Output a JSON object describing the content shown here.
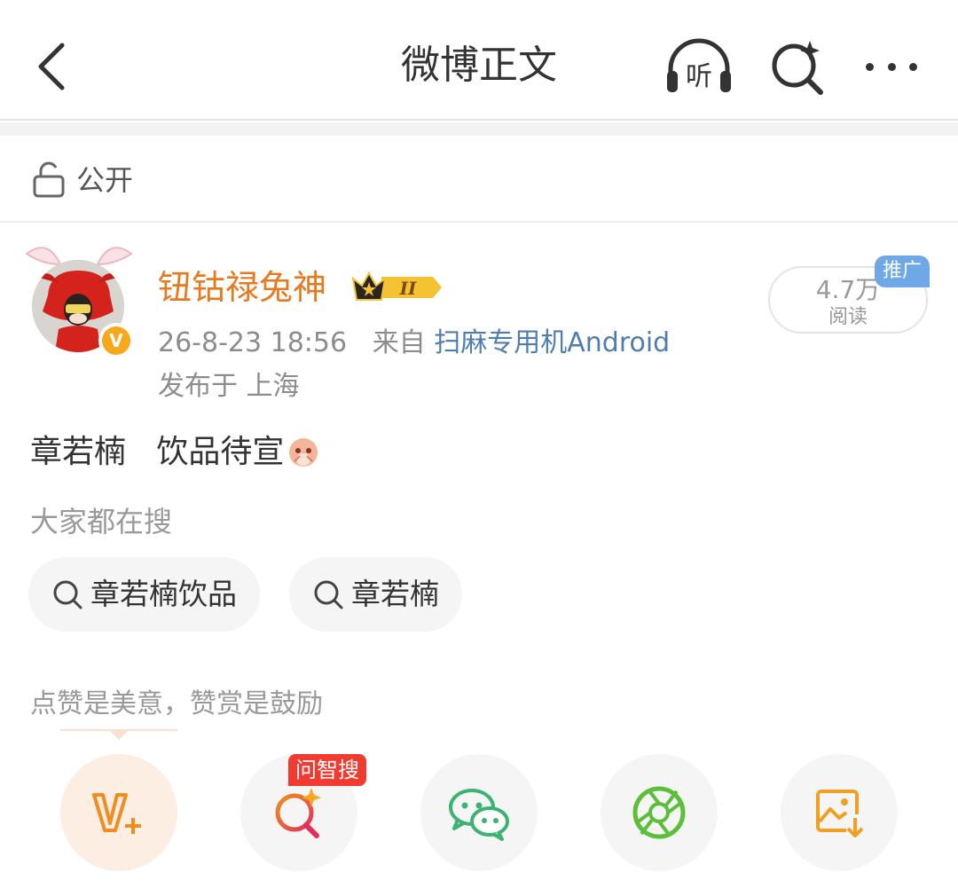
{
  "header": {
    "title": "微博正文",
    "listen_label": "听"
  },
  "visibility": {
    "label": "公开"
  },
  "post": {
    "author": "钮钴禄兔神",
    "vip_level": "II",
    "avatar_badge": "V",
    "time": "26-8-23 18:56",
    "source_prefix": "来自",
    "source": "扫麻专用机Android",
    "location": "发布于 上海",
    "reads_count": "4.7万",
    "reads_label": "阅读",
    "promo_tag": "推广",
    "text": "章若楠   饮品待宣"
  },
  "related_search": {
    "title": "大家都在搜",
    "chips": [
      {
        "label": "章若楠饮品"
      },
      {
        "label": "章若楠"
      }
    ]
  },
  "actions": {
    "tip": "点赞是美意，赞赏是鼓励",
    "ai_tag": "问智搜",
    "buttons": [
      {
        "icon": "reward-v-plus-icon",
        "color": "#f08c20"
      },
      {
        "icon": "ai-search-icon",
        "color": "#e83e5a"
      },
      {
        "icon": "wechat-icon",
        "color": "#3cb371"
      },
      {
        "icon": "moments-icon",
        "color": "#5cbf3a"
      },
      {
        "icon": "save-image-icon",
        "color": "#f0a020"
      }
    ]
  }
}
